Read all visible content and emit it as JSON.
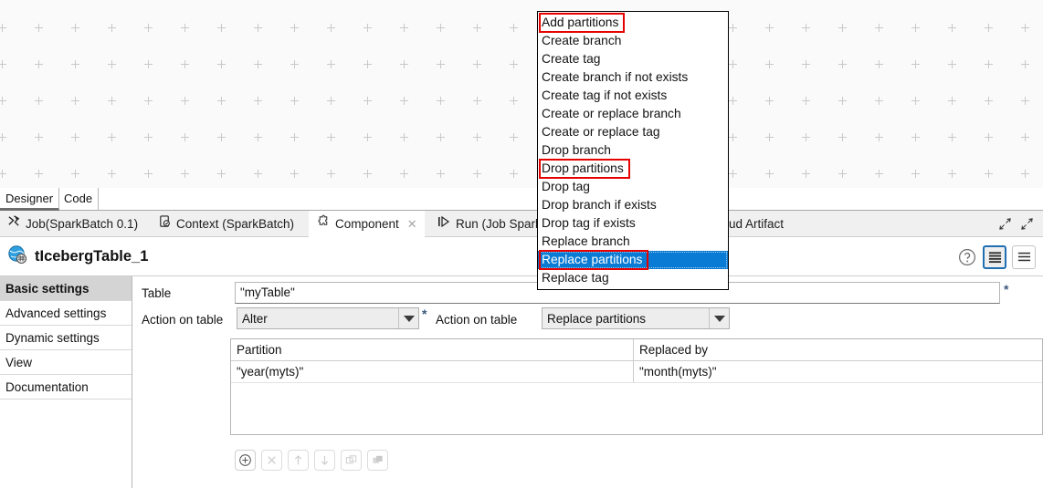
{
  "canvas": {
    "name": "job-designer-canvas"
  },
  "view_tabs": [
    {
      "label": "Designer",
      "selected": true
    },
    {
      "label": "Code",
      "selected": false
    }
  ],
  "component_tabs": [
    {
      "label": "Job(SparkBatch 0.1)",
      "icon": "job-icon",
      "active": false,
      "closable": false
    },
    {
      "label": "Context (SparkBatch)",
      "icon": "context-icon",
      "active": false,
      "closable": false
    },
    {
      "label": "Component",
      "icon": "component-puzzle-icon",
      "active": true,
      "closable": true
    },
    {
      "label": "Run (Job Spark",
      "icon": "run-icon",
      "active": false,
      "closable": false
    },
    {
      "label": "ud Artifact",
      "icon": "",
      "active": false,
      "closable": false
    }
  ],
  "window_controls": [
    {
      "name": "restore-icon"
    },
    {
      "name": "maximize-icon"
    }
  ],
  "header": {
    "title": "tIcebergTable_1",
    "icon": "iceberg-table-component-icon",
    "help_icon": "help-question-icon",
    "view_toggles": [
      {
        "name": "compact-view-toggle",
        "selected": true
      },
      {
        "name": "expanded-view-toggle",
        "selected": false
      }
    ]
  },
  "sidebar": {
    "items": [
      {
        "label": "Basic settings",
        "selected": true
      },
      {
        "label": "Advanced settings",
        "selected": false
      },
      {
        "label": "Dynamic settings",
        "selected": false
      },
      {
        "label": "View",
        "selected": false
      },
      {
        "label": "Documentation",
        "selected": false
      }
    ]
  },
  "form": {
    "table_label": "Table",
    "table_value": "\"myTable\"",
    "table_required": "*",
    "action_label_1": "Action on table",
    "action_value_1": "Alter",
    "action_required_1": "*",
    "action_label_2": "Action on table",
    "action_value_2": "Replace partitions"
  },
  "grid": {
    "columns": [
      "Partition",
      "Replaced by"
    ],
    "rows": [
      {
        "partition": "\"year(myts)\"",
        "replaced_by": "\"month(myts)\""
      }
    ],
    "toolbar": [
      {
        "name": "add-row-button",
        "glyph": "plus-circle-icon",
        "enabled": true
      },
      {
        "name": "remove-row-button",
        "glyph": "close-x-icon",
        "enabled": false
      },
      {
        "name": "move-up-button",
        "glyph": "arrow-up-icon",
        "enabled": false
      },
      {
        "name": "move-down-button",
        "glyph": "arrow-down-icon",
        "enabled": false
      },
      {
        "name": "copy-button",
        "glyph": "copy-icon",
        "enabled": false
      },
      {
        "name": "paste-button",
        "glyph": "paste-icon",
        "enabled": false
      }
    ]
  },
  "dropdown": {
    "name": "action-on-table-dropdown-list",
    "items": [
      {
        "label": "Add partitions",
        "highlighted": false,
        "annotated": true
      },
      {
        "label": "Create branch",
        "highlighted": false,
        "annotated": false
      },
      {
        "label": "Create tag",
        "highlighted": false,
        "annotated": false
      },
      {
        "label": "Create branch if not exists",
        "highlighted": false,
        "annotated": false
      },
      {
        "label": "Create tag if not exists",
        "highlighted": false,
        "annotated": false
      },
      {
        "label": "Create or replace branch",
        "highlighted": false,
        "annotated": false
      },
      {
        "label": "Create or replace tag",
        "highlighted": false,
        "annotated": false
      },
      {
        "label": "Drop branch",
        "highlighted": false,
        "annotated": false
      },
      {
        "label": "Drop partitions",
        "highlighted": false,
        "annotated": true
      },
      {
        "label": "Drop tag",
        "highlighted": false,
        "annotated": false
      },
      {
        "label": "Drop branch if exists",
        "highlighted": false,
        "annotated": false
      },
      {
        "label": "Drop tag if exists",
        "highlighted": false,
        "annotated": false
      },
      {
        "label": "Replace branch",
        "highlighted": false,
        "annotated": false
      },
      {
        "label": "Replace partitions",
        "highlighted": true,
        "annotated": true
      },
      {
        "label": "Replace tag",
        "highlighted": false,
        "annotated": false
      }
    ]
  },
  "colors": {
    "highlight": "#0a7bd4",
    "annotation": "#e60000",
    "accent": "#1f6fb2",
    "canvas_bg": "#fafafa",
    "panel_bg": "#f0f0f0"
  }
}
